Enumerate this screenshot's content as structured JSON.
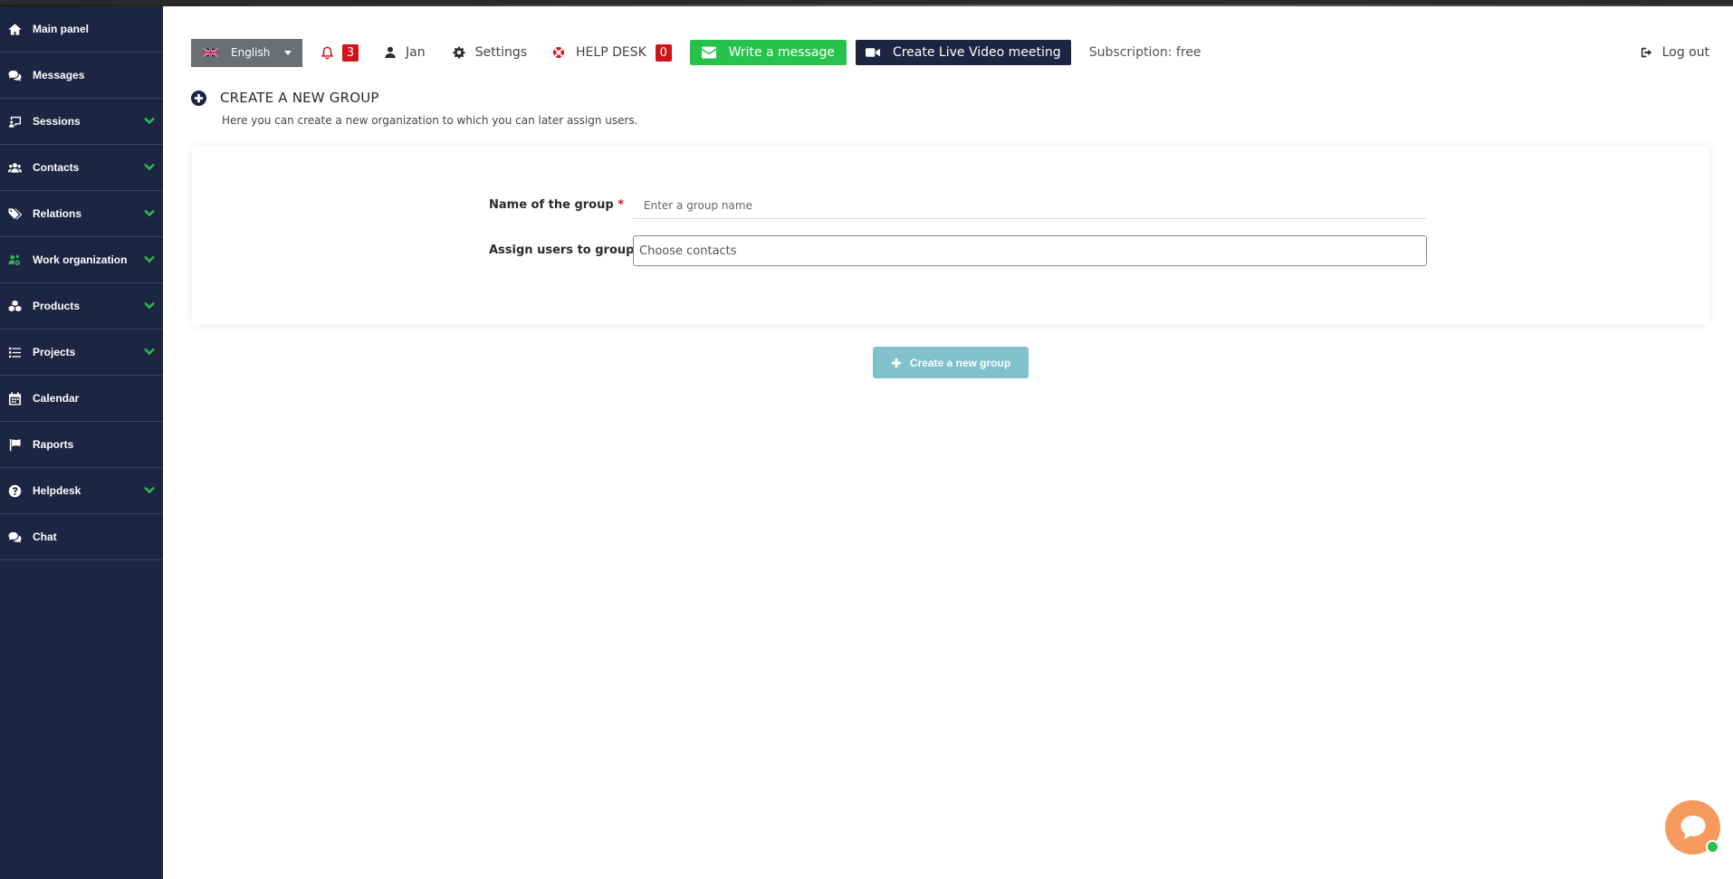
{
  "sidebar": {
    "items": [
      {
        "label": "Main panel",
        "icon": "home-icon",
        "expandable": false
      },
      {
        "label": "Messages",
        "icon": "comments-icon",
        "expandable": false
      },
      {
        "label": "Sessions",
        "icon": "presentation-icon",
        "expandable": true
      },
      {
        "label": "Contacts",
        "icon": "users-icon",
        "expandable": true
      },
      {
        "label": "Relations",
        "icon": "tags-icon",
        "expandable": true
      },
      {
        "label": "Work organization",
        "icon": "users-cog-icon",
        "expandable": true,
        "active": true
      },
      {
        "label": "Products",
        "icon": "cubes-icon",
        "expandable": true
      },
      {
        "label": "Projects",
        "icon": "tasks-icon",
        "expandable": true
      },
      {
        "label": "Calendar",
        "icon": "calendar-icon",
        "expandable": false
      },
      {
        "label": "Raports",
        "icon": "flag-icon",
        "expandable": false
      },
      {
        "label": "Helpdesk",
        "icon": "question-circle-icon",
        "expandable": true
      },
      {
        "label": "Chat",
        "icon": "comments-icon",
        "expandable": false
      }
    ]
  },
  "header": {
    "language": "English",
    "notifications_count": "3",
    "user_name": "Jan",
    "settings_label": "Settings",
    "helpdesk_label": "HELP DESK",
    "helpdesk_count": "0",
    "write_message_label": "Write a message",
    "video_meeting_label": "Create Live Video meeting",
    "subscription": "Subscription: free",
    "logout_label": "Log out"
  },
  "page": {
    "title": "CREATE A NEW GROUP",
    "subtitle": "Here you can create a new organization to which you can later assign users."
  },
  "form": {
    "name_label": "Name of the group",
    "required_mark": "*",
    "name_placeholder": "Enter a group name",
    "name_value": "",
    "assign_label": "Assign users to group",
    "assign_placeholder": "Choose contacts"
  },
  "actions": {
    "create_label": "Create a new group"
  },
  "colors": {
    "sidebar_bg": "#1c2541",
    "accent_green": "#27c24c",
    "badge_red": "#d0141c",
    "create_button": "#80c1cb",
    "chat_fab": "#f79a5f"
  }
}
